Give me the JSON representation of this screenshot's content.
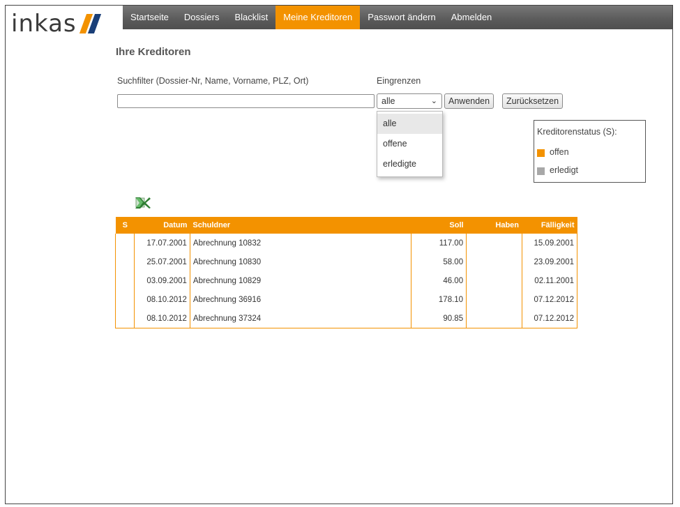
{
  "logo": {
    "text": "inkas"
  },
  "nav": {
    "items": [
      "Startseite",
      "Dossiers",
      "Blacklist",
      "Meine Kreditoren",
      "Passwort ändern",
      "Abmelden"
    ],
    "active_index": 3
  },
  "page": {
    "title": "Ihre Kreditoren"
  },
  "search": {
    "label": "Suchfilter (Dossier-Nr, Name, Vorname, PLZ, Ort)",
    "value": ""
  },
  "filter": {
    "label": "Eingrenzen",
    "selected": "alle",
    "options": [
      "alle",
      "offene",
      "erledigte"
    ],
    "apply_label": "Anwenden",
    "reset_label": "Zurücksetzen"
  },
  "legend": {
    "title": "Kreditorenstatus (S):",
    "items": [
      {
        "label": "offen",
        "color": "#f39200"
      },
      {
        "label": "erledigt",
        "color": "#a8a8a8"
      }
    ]
  },
  "export": {
    "icon": "excel-icon"
  },
  "table": {
    "headers": {
      "status": "S",
      "date": "Datum",
      "debtor": "Schuldner",
      "soll": "Soll",
      "haben": "Haben",
      "due": "Fälligkeit"
    },
    "rows": [
      {
        "status": "",
        "date": "17.07.2001",
        "debtor": "Abrechnung 10832",
        "soll": "117.00",
        "haben": "",
        "due": "15.09.2001"
      },
      {
        "status": "",
        "date": "25.07.2001",
        "debtor": "Abrechnung 10830",
        "soll": "58.00",
        "haben": "",
        "due": "23.09.2001"
      },
      {
        "status": "",
        "date": "03.09.2001",
        "debtor": "Abrechnung 10829",
        "soll": "46.00",
        "haben": "",
        "due": "02.11.2001"
      },
      {
        "status": "",
        "date": "08.10.2012",
        "debtor": "Abrechnung 36916",
        "soll": "178.10",
        "haben": "",
        "due": "07.12.2012"
      },
      {
        "status": "",
        "date": "08.10.2012",
        "debtor": "Abrechnung 37324",
        "soll": "90.85",
        "haben": "",
        "due": "07.12.2012"
      }
    ]
  },
  "colors": {
    "accent": "#f39200",
    "nav_bg": "#5a5a5a",
    "logo_blue": "#1a3f78"
  }
}
